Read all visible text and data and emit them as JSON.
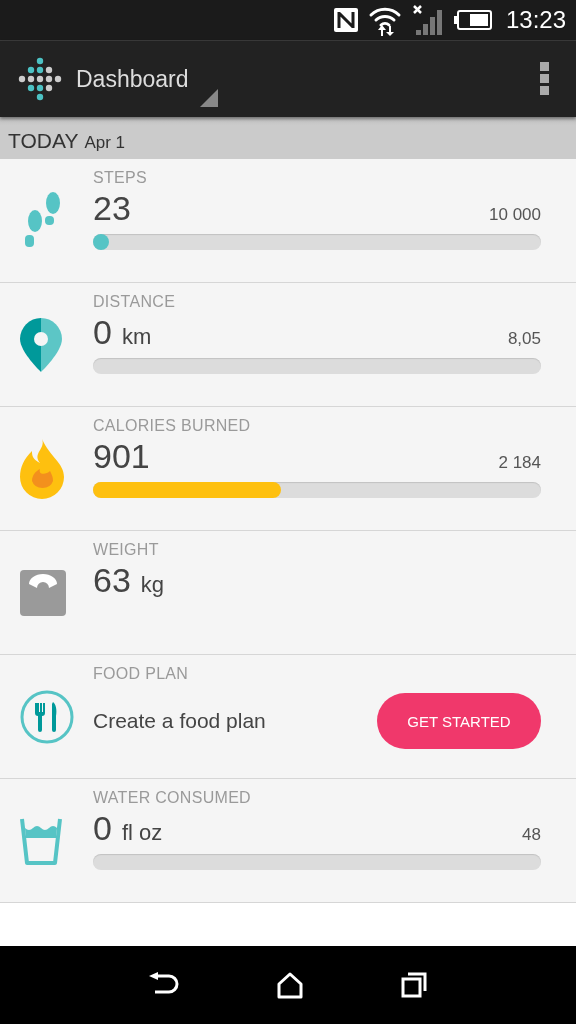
{
  "status_bar": {
    "time": "13:23"
  },
  "app_bar": {
    "title": "Dashboard"
  },
  "date_header": {
    "day": "TODAY",
    "date": "Apr 1"
  },
  "tiles": [
    {
      "kind": "progress",
      "label": "STEPS",
      "value": "23",
      "goal": "10 000",
      "level": 0.02,
      "color": "#56c4c5"
    },
    {
      "kind": "progress",
      "label": "DISTANCE",
      "value": "0",
      "unit": "km",
      "goal": "8,05"
    },
    {
      "kind": "progress",
      "label": "CALORIES BURNED",
      "value": "901",
      "goal": "2 184",
      "level": 0.42,
      "color": "#fec00f"
    },
    {
      "kind": "value",
      "label": "WEIGHT",
      "value": "63",
      "unit": "kg"
    },
    {
      "kind": "action",
      "label": "FOOD PLAN",
      "text": "Create a food plan",
      "button": "GET STARTED"
    },
    {
      "kind": "progress",
      "label": "WATER CONSUMED",
      "value": "0",
      "unit": "fl oz",
      "goal": "48"
    }
  ]
}
